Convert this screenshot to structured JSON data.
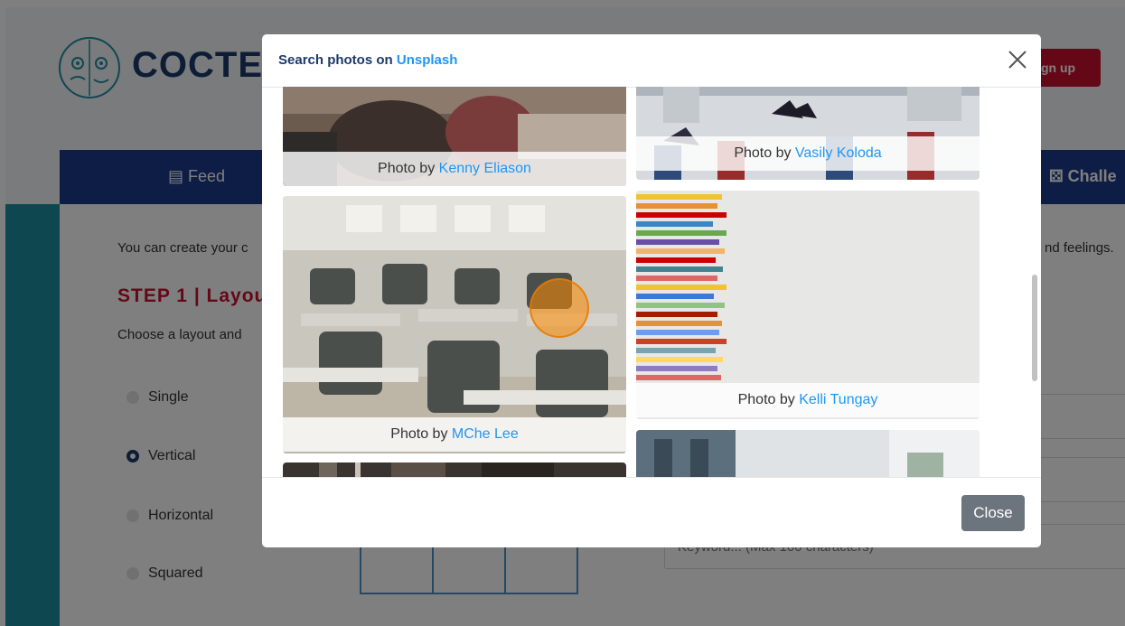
{
  "background": {
    "brand": "COCTEA",
    "signup_label": "gn up",
    "nav": {
      "feed_label": "Feed",
      "challenges_label": "Challe"
    },
    "intro_text": "You can create your c",
    "intro_text_right": "nd feelings.",
    "step_heading": "STEP 1 | Layou",
    "choose_text": "Choose a layout and",
    "layouts": [
      {
        "label": "Single",
        "selected": false
      },
      {
        "label": "Vertical",
        "selected": true
      },
      {
        "label": "Horizontal",
        "selected": false
      },
      {
        "label": "Squared",
        "selected": false
      }
    ],
    "keyword_placeholder": "Keyword... (Max 100 characters)"
  },
  "modal": {
    "title_prefix": "Search photos on ",
    "title_link": "Unsplash",
    "close_button_label": "Close",
    "photo_caption_prefix": "Photo by",
    "photos": [
      {
        "author": "Kenny Eliason"
      },
      {
        "author": "Vasily Koloda"
      },
      {
        "author": "MChe Lee"
      },
      {
        "author": "Kelli Tungay"
      }
    ]
  },
  "colors": {
    "brand_navy": "#1b3a6b",
    "nav_blue": "#1b3a8c",
    "accent_red": "#c8102e",
    "link_blue": "#2196f3",
    "teal": "#1f8ea3",
    "close_gray": "#6c757d"
  },
  "icons": [
    "logo-faces-icon",
    "newspaper-icon",
    "dice-icon",
    "close-icon"
  ]
}
